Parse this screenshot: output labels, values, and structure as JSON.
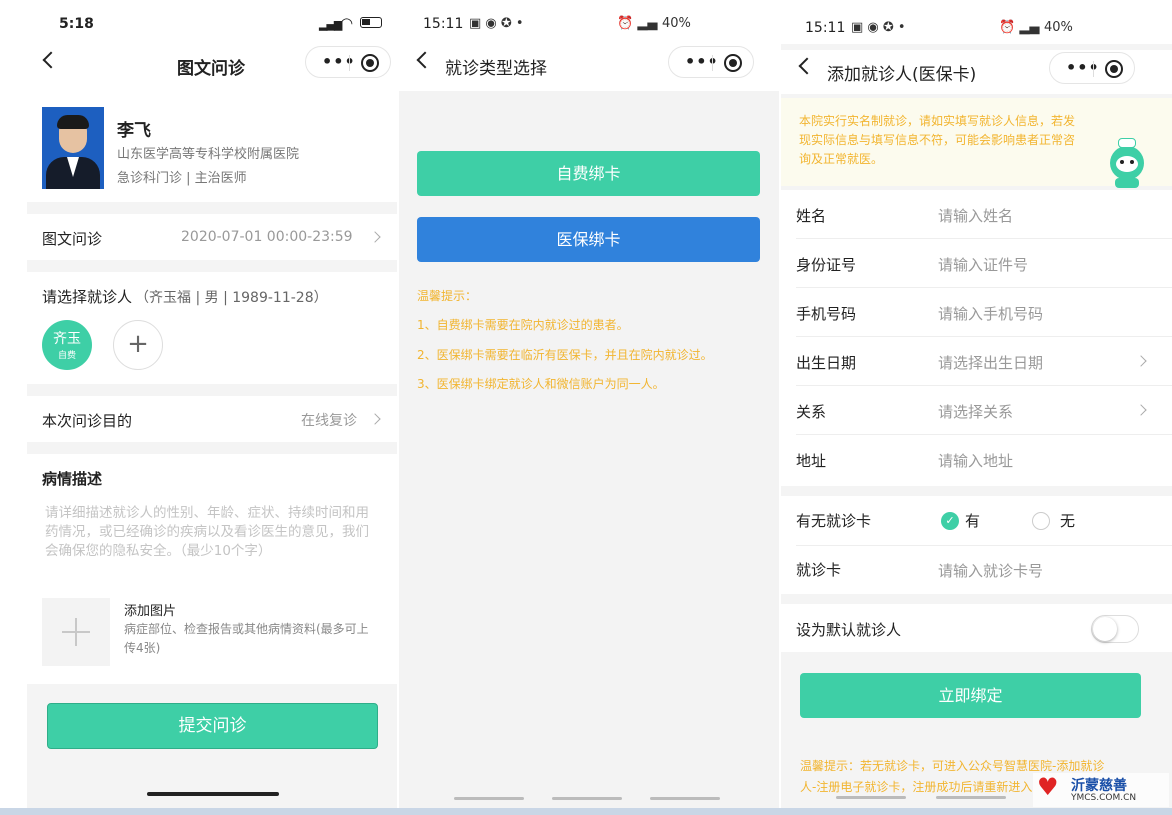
{
  "screen1": {
    "status_time": "5:18",
    "title": "图文问诊",
    "doctor": {
      "name": "李飞",
      "hospital": "山东医学高等专科学校附属医院",
      "dept_title": "急诊科门诊 | 主治医师"
    },
    "service": {
      "label": "图文问诊",
      "value": "2020-07-01 00:00-23:59"
    },
    "patient": {
      "label": "请选择就诊人",
      "selected": "（齐玉福 | 男 | 1989-11-28）",
      "avatar_name": "齐玉",
      "avatar_tag": "自费",
      "add_symbol": "+"
    },
    "purpose": {
      "label": "本次问诊目的",
      "value": "在线复诊"
    },
    "description": {
      "label": "病情描述",
      "placeholder": "请详细描述就诊人的性别、年龄、症状、持续时间和用药情况，或已经确诊的疾病以及看诊医生的意见，我们会确保您的隐私安全。（最少10个字）"
    },
    "add_image": {
      "title": "添加图片",
      "hint": "病症部位、检查报告或其他病情资料(最多可上传4张)"
    },
    "submit_label": "提交问诊"
  },
  "screen2": {
    "status_time": "15:11",
    "status_battery": "40%",
    "title": "就诊类型选择",
    "self_pay_button": "自费绑卡",
    "insurance_button": "医保绑卡",
    "tips_title": "温馨提示：",
    "tips": [
      "1、自费绑卡需要在院内就诊过的患者。",
      "2、医保绑卡需要在临沂有医保卡，并且在院内就诊过。",
      "3、医保绑卡绑定就诊人和微信账户为同一人。"
    ]
  },
  "screen3": {
    "status_time": "15:11",
    "status_battery": "40%",
    "title": "添加就诊人(医保卡)",
    "notice": "本院实行实名制就诊，请如实填写就诊人信息，若发现实际信息与填写信息不符，可能会影响患者正常咨询及正常就医。",
    "fields": [
      {
        "label": "姓名",
        "placeholder": "请输入姓名"
      },
      {
        "label": "身份证号",
        "placeholder": "请输入证件号"
      },
      {
        "label": "手机号码",
        "placeholder": "请输入手机号码"
      },
      {
        "label": "出生日期",
        "placeholder": "请选择出生日期"
      },
      {
        "label": "关系",
        "placeholder": "请选择关系"
      },
      {
        "label": "地址",
        "placeholder": "请输入地址"
      }
    ],
    "card_question": {
      "label": "有无就诊卡",
      "yes": "有",
      "no": "无"
    },
    "card_number": {
      "label": "就诊卡",
      "placeholder": "请输入就诊卡号"
    },
    "default_label": "设为默认就诊人",
    "bind_label": "立即绑定",
    "bottom_tip_line1": "温馨提示：若无就诊卡，可进入公众号智慧医院-添加就诊",
    "bottom_tip_line2": "人-注册电子就诊卡，注册成功后请重新进入"
  },
  "watermark": {
    "name": "沂蒙慈善",
    "url": "YMCS.COM.CN"
  },
  "colors": {
    "green": "#3ecfa6",
    "blue": "#3082dc",
    "orange": "#f2b530"
  }
}
